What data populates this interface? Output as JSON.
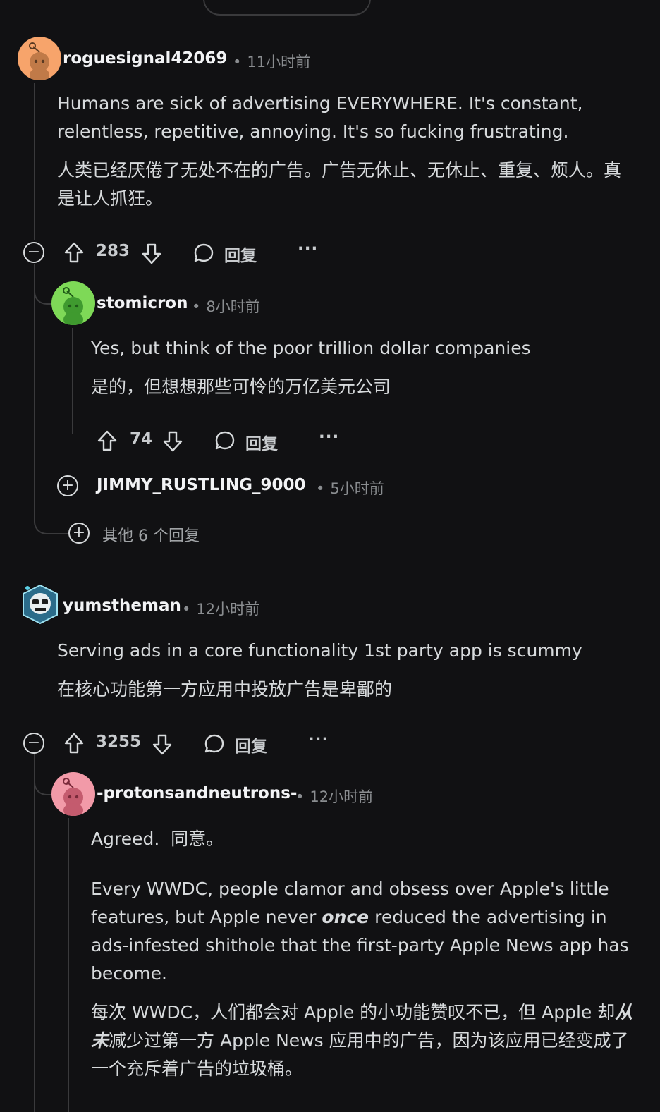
{
  "comments": [
    {
      "username": "roguesignal42069",
      "time": "11小时前",
      "body_en": "Humans are sick of advertising EVERYWHERE. It's constant, relentless, repetitive, annoying. It's so fucking frustrating.",
      "body_zh": "人类已经厌倦了无处不在的广告。广告无休止、无休止、重复、烦人。真是让人抓狂。",
      "votes": "283",
      "reply_label": "回复",
      "avatar_color": "#f7a46b"
    },
    {
      "username": "stomicron",
      "time": "8小时前",
      "body_en": "Yes, but think of the poor trillion dollar companies",
      "body_zh": "是的，但想想那些可怜的万亿美元公司",
      "votes": "74",
      "reply_label": "回复",
      "avatar_color": "#7ed957"
    },
    {
      "username": "JIMMY_RUSTLING_9000",
      "time": "5小时前"
    },
    {
      "more_replies": "其他 6 个回复"
    },
    {
      "username": "yumstheman",
      "time": "12小时前",
      "body_en": "Serving ads in a core functionality 1st party app is scummy",
      "body_zh": "在核心功能第一方应用中投放广告是卑鄙的",
      "votes": "3255",
      "reply_label": "回复"
    },
    {
      "username": "-protonsandneutrons-",
      "time": "12小时前",
      "body_line1": "Agreed.  同意。",
      "body_en_p1": "Every WWDC, people clamor and obsess over Apple's little features, but Apple never ",
      "body_en_em": "once",
      "body_en_p2": " reduced the advertising in ads-infested shithole that the first-party Apple News app has become.",
      "body_zh_p1": "每次 WWDC，人们都会对 Apple 的小功能赞叹不已，但 Apple 却",
      "body_zh_em": "从未",
      "body_zh_p2": "减少过第一方 Apple News 应用中的广告，因为该应用已经变成了一个充斥着广告的垃圾桶。",
      "avatar_color": "#f29aa8"
    }
  ],
  "dot": "•",
  "more_icon": "···"
}
